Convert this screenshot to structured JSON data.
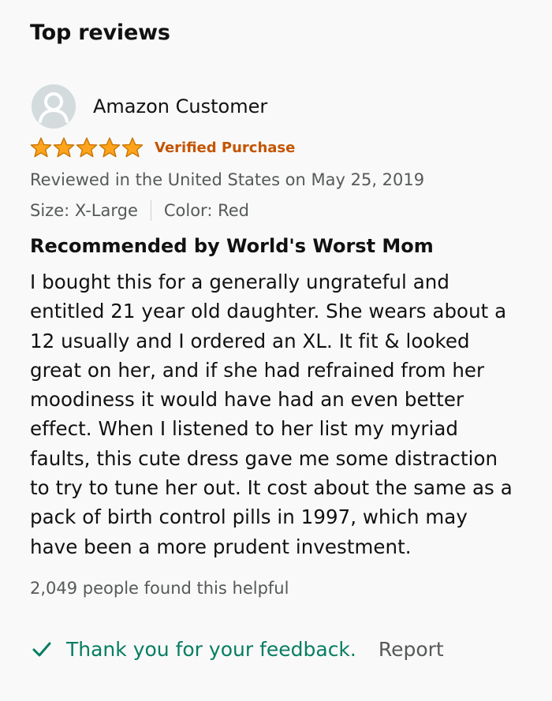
{
  "section": {
    "title": "Top reviews"
  },
  "review": {
    "author": "Amazon Customer",
    "avatar_icon": "user-silhouette-icon",
    "rating": 5,
    "rating_max": 5,
    "star_color": "#ffa41c",
    "verified_label": "Verified Purchase",
    "verified_color": "#c45500",
    "reviewed_line": "Reviewed in the United States on May 25, 2019",
    "size_label": "Size: X-Large",
    "color_label": "Color: Red",
    "title": "Recommended by World's Worst Mom",
    "body_lines": [
      "I bought this for a generally ungrateful and",
      "entitled 21 year old daughter. She wears about a",
      "12 usually and I ordered an XL. It fit & looked",
      "great on her, and if she had refrained from her",
      "moodiness it would have had an even better",
      "effect. When I listened to her list my myriad",
      "faults, this cute dress gave me some distraction",
      "to try to tune her out. It cost about the same as a",
      "pack of birth control pills in 1997, which may",
      "have been a more prudent investment."
    ],
    "helpful_text": "2,049 people found this helpful",
    "feedback_text": "Thank you for your feedback.",
    "feedback_color": "#067d62",
    "report_label": "Report"
  }
}
